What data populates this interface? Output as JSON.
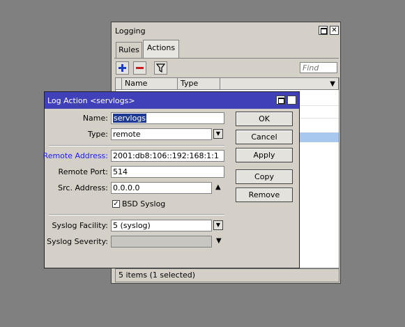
{
  "logging_window": {
    "title": "Logging",
    "tabs": [
      {
        "label": "Rules"
      },
      {
        "label": "Actions"
      }
    ],
    "find_placeholder": "Find",
    "columns": [
      {
        "label": "Name"
      },
      {
        "label": "Type"
      }
    ],
    "status": "5 items (1 selected)"
  },
  "dialog": {
    "title": "Log Action <servlogs>",
    "fields": {
      "name": {
        "label": "Name:",
        "value": "servlogs"
      },
      "type": {
        "label": "Type:",
        "value": "remote"
      },
      "remote_address": {
        "label": "Remote Address:",
        "value": "2001:db8:106::192:168:1:1"
      },
      "remote_port": {
        "label": "Remote Port:",
        "value": "514"
      },
      "src_address": {
        "label": "Src. Address:",
        "value": "0.0.0.0"
      },
      "bsd_syslog": {
        "label": "BSD Syslog",
        "checked": true
      },
      "syslog_facility": {
        "label": "Syslog Facility:",
        "value": "5 (syslog)"
      },
      "syslog_severity": {
        "label": "Syslog Severity:",
        "value": ""
      }
    },
    "buttons": {
      "ok": "OK",
      "cancel": "Cancel",
      "apply": "Apply",
      "copy": "Copy",
      "remove": "Remove"
    },
    "remote_address_label_color": "#1a1aff"
  },
  "colors": {
    "desktop": "#808080",
    "window_bg": "#d4d0c8",
    "dialog_titlebar": "#4040b8",
    "selected_row": "#a8c8f0"
  }
}
